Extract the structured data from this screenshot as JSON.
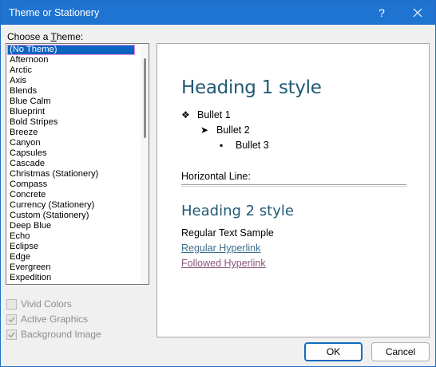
{
  "window": {
    "title": "Theme or Stationery",
    "help_label": "?"
  },
  "theme_list": {
    "label_prefix": "Choose a ",
    "label_accel": "T",
    "label_suffix": "heme:",
    "items": [
      "(No Theme)",
      "Afternoon",
      "Arctic",
      "Axis",
      "Blends",
      "Blue Calm",
      "Blueprint",
      "Bold Stripes",
      "Breeze",
      "Canyon",
      "Capsules",
      "Cascade",
      "Christmas (Stationery)",
      "Compass",
      "Concrete",
      "Currency (Stationery)",
      "Custom (Stationery)",
      "Deep Blue",
      "Echo",
      "Eclipse",
      "Edge",
      "Evergreen",
      "Expedition"
    ],
    "selected": "(No Theme)"
  },
  "options": {
    "vivid_colors": {
      "label": "Vivid Colors",
      "checked": false
    },
    "active_graphics": {
      "label": "Active Graphics",
      "checked": true
    },
    "background_image": {
      "label": "Background Image",
      "checked": true
    }
  },
  "preview": {
    "heading1": "Heading 1 style",
    "bullet1": "Bullet 1",
    "bullet2": "Bullet 2",
    "bullet3": "Bullet 3",
    "bullet1_symbol": "❖",
    "bullet2_symbol": "➤",
    "bullet3_symbol": "▪",
    "hr_label": "Horizontal Line:",
    "heading2": "Heading 2 style",
    "regular_text": "Regular Text Sample",
    "hyperlink": "Regular Hyperlink",
    "followed_hyperlink": "Followed Hyperlink",
    "colors": {
      "heading": "#215a74",
      "link": "#3c6d8c",
      "followed": "#87557a"
    }
  },
  "buttons": {
    "ok": "OK",
    "cancel": "Cancel"
  }
}
